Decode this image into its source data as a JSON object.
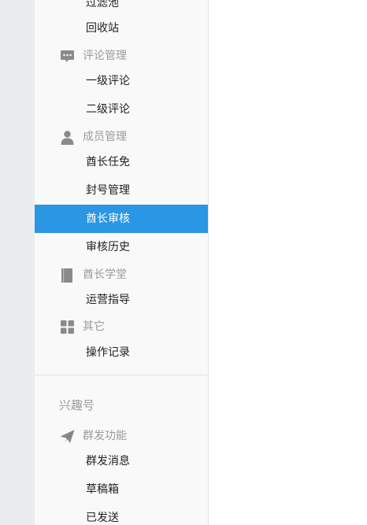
{
  "sidebar": {
    "top_cut_item": "过滤池",
    "items_recycle": "回收站",
    "group_comments": {
      "label": "评论管理",
      "icon": "comment-icon"
    },
    "comment_lv1": "一级评论",
    "comment_lv2": "二级评论",
    "group_members": {
      "label": "成员管理",
      "icon": "person-icon"
    },
    "member_appoint": "酋长任免",
    "member_ban": "封号管理",
    "member_review": "酋长审核",
    "member_history": "审核历史",
    "group_school": {
      "label": "酋长学堂",
      "icon": "book-icon"
    },
    "school_guide": "运营指导",
    "group_other": {
      "label": "其它",
      "icon": "grid-icon"
    },
    "other_log": "操作记录",
    "section_interest": "兴趣号",
    "group_broadcast": {
      "label": "群发功能",
      "icon": "paper-plane-icon"
    },
    "broadcast_send": "群发消息",
    "broadcast_drafts": "草稿箱",
    "broadcast_sent": "已发送"
  },
  "colors": {
    "active_bg": "#2a96e4",
    "group_text": "#9b9b9b",
    "icon": "#8a8a8a"
  }
}
